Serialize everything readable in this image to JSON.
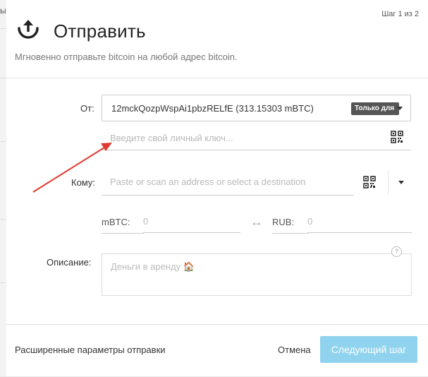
{
  "background": {
    "fragment": "ы"
  },
  "modal": {
    "step": "Шаг 1 из 2",
    "title": "Отправить",
    "subtitle": "Мгновенно отправьте bitcoin на любой адрес bitcoin.",
    "icons": {
      "header": "upload-icon",
      "qr": "qr-code-icon",
      "dropdown": "chevron-down-icon",
      "swap": "swap-arrows-icon",
      "help": "help-circle-icon"
    }
  },
  "form": {
    "from": {
      "label": "От:",
      "value": "12mckQozpWspAi1pbzRELfE (313.15303 mBTC)",
      "badge": "Только для"
    },
    "private_key": {
      "placeholder": "Введите свой личный ключ..."
    },
    "to": {
      "label": "Кому:",
      "placeholder": "Paste or scan an address or select a destination"
    },
    "amount": {
      "btc_label": "mBTC:",
      "btc_placeholder": "0",
      "fiat_label": "RUB:",
      "fiat_placeholder": "0",
      "swap_glyph": "↔"
    },
    "description": {
      "label": "Описание:",
      "placeholder": "Деньги в аренду 🏠",
      "help": "?"
    }
  },
  "footer": {
    "advanced": "Расширенные параметры отправки",
    "cancel": "Отмена",
    "next": "Следующий шаг"
  },
  "colors": {
    "primary_button": "#8fd3ee",
    "annotation_arrow": "#e03a2f",
    "badge": "#555555"
  }
}
